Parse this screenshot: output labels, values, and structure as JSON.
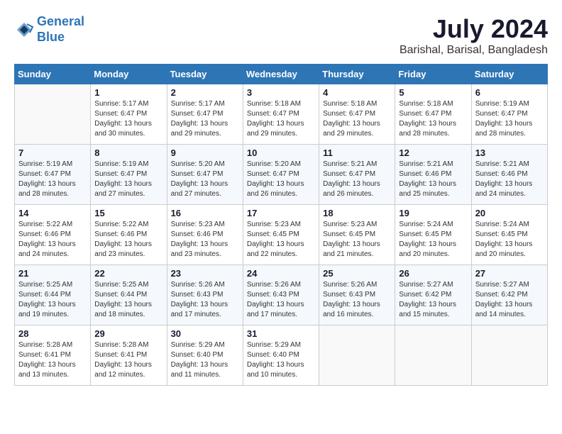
{
  "header": {
    "logo_line1": "General",
    "logo_line2": "Blue",
    "month_year": "July 2024",
    "location": "Barishal, Barisal, Bangladesh"
  },
  "weekdays": [
    "Sunday",
    "Monday",
    "Tuesday",
    "Wednesday",
    "Thursday",
    "Friday",
    "Saturday"
  ],
  "weeks": [
    [
      {
        "day": "",
        "sunrise": "",
        "sunset": "",
        "daylight": ""
      },
      {
        "day": "1",
        "sunrise": "5:17 AM",
        "sunset": "6:47 PM",
        "daylight": "13 hours and 30 minutes."
      },
      {
        "day": "2",
        "sunrise": "5:17 AM",
        "sunset": "6:47 PM",
        "daylight": "13 hours and 29 minutes."
      },
      {
        "day": "3",
        "sunrise": "5:18 AM",
        "sunset": "6:47 PM",
        "daylight": "13 hours and 29 minutes."
      },
      {
        "day": "4",
        "sunrise": "5:18 AM",
        "sunset": "6:47 PM",
        "daylight": "13 hours and 29 minutes."
      },
      {
        "day": "5",
        "sunrise": "5:18 AM",
        "sunset": "6:47 PM",
        "daylight": "13 hours and 28 minutes."
      },
      {
        "day": "6",
        "sunrise": "5:19 AM",
        "sunset": "6:47 PM",
        "daylight": "13 hours and 28 minutes."
      }
    ],
    [
      {
        "day": "7",
        "sunrise": "5:19 AM",
        "sunset": "6:47 PM",
        "daylight": "13 hours and 28 minutes."
      },
      {
        "day": "8",
        "sunrise": "5:19 AM",
        "sunset": "6:47 PM",
        "daylight": "13 hours and 27 minutes."
      },
      {
        "day": "9",
        "sunrise": "5:20 AM",
        "sunset": "6:47 PM",
        "daylight": "13 hours and 27 minutes."
      },
      {
        "day": "10",
        "sunrise": "5:20 AM",
        "sunset": "6:47 PM",
        "daylight": "13 hours and 26 minutes."
      },
      {
        "day": "11",
        "sunrise": "5:21 AM",
        "sunset": "6:47 PM",
        "daylight": "13 hours and 26 minutes."
      },
      {
        "day": "12",
        "sunrise": "5:21 AM",
        "sunset": "6:46 PM",
        "daylight": "13 hours and 25 minutes."
      },
      {
        "day": "13",
        "sunrise": "5:21 AM",
        "sunset": "6:46 PM",
        "daylight": "13 hours and 24 minutes."
      }
    ],
    [
      {
        "day": "14",
        "sunrise": "5:22 AM",
        "sunset": "6:46 PM",
        "daylight": "13 hours and 24 minutes."
      },
      {
        "day": "15",
        "sunrise": "5:22 AM",
        "sunset": "6:46 PM",
        "daylight": "13 hours and 23 minutes."
      },
      {
        "day": "16",
        "sunrise": "5:23 AM",
        "sunset": "6:46 PM",
        "daylight": "13 hours and 23 minutes."
      },
      {
        "day": "17",
        "sunrise": "5:23 AM",
        "sunset": "6:45 PM",
        "daylight": "13 hours and 22 minutes."
      },
      {
        "day": "18",
        "sunrise": "5:23 AM",
        "sunset": "6:45 PM",
        "daylight": "13 hours and 21 minutes."
      },
      {
        "day": "19",
        "sunrise": "5:24 AM",
        "sunset": "6:45 PM",
        "daylight": "13 hours and 20 minutes."
      },
      {
        "day": "20",
        "sunrise": "5:24 AM",
        "sunset": "6:45 PM",
        "daylight": "13 hours and 20 minutes."
      }
    ],
    [
      {
        "day": "21",
        "sunrise": "5:25 AM",
        "sunset": "6:44 PM",
        "daylight": "13 hours and 19 minutes."
      },
      {
        "day": "22",
        "sunrise": "5:25 AM",
        "sunset": "6:44 PM",
        "daylight": "13 hours and 18 minutes."
      },
      {
        "day": "23",
        "sunrise": "5:26 AM",
        "sunset": "6:43 PM",
        "daylight": "13 hours and 17 minutes."
      },
      {
        "day": "24",
        "sunrise": "5:26 AM",
        "sunset": "6:43 PM",
        "daylight": "13 hours and 17 minutes."
      },
      {
        "day": "25",
        "sunrise": "5:26 AM",
        "sunset": "6:43 PM",
        "daylight": "13 hours and 16 minutes."
      },
      {
        "day": "26",
        "sunrise": "5:27 AM",
        "sunset": "6:42 PM",
        "daylight": "13 hours and 15 minutes."
      },
      {
        "day": "27",
        "sunrise": "5:27 AM",
        "sunset": "6:42 PM",
        "daylight": "13 hours and 14 minutes."
      }
    ],
    [
      {
        "day": "28",
        "sunrise": "5:28 AM",
        "sunset": "6:41 PM",
        "daylight": "13 hours and 13 minutes."
      },
      {
        "day": "29",
        "sunrise": "5:28 AM",
        "sunset": "6:41 PM",
        "daylight": "13 hours and 12 minutes."
      },
      {
        "day": "30",
        "sunrise": "5:29 AM",
        "sunset": "6:40 PM",
        "daylight": "13 hours and 11 minutes."
      },
      {
        "day": "31",
        "sunrise": "5:29 AM",
        "sunset": "6:40 PM",
        "daylight": "13 hours and 10 minutes."
      },
      {
        "day": "",
        "sunrise": "",
        "sunset": "",
        "daylight": ""
      },
      {
        "day": "",
        "sunrise": "",
        "sunset": "",
        "daylight": ""
      },
      {
        "day": "",
        "sunrise": "",
        "sunset": "",
        "daylight": ""
      }
    ]
  ]
}
